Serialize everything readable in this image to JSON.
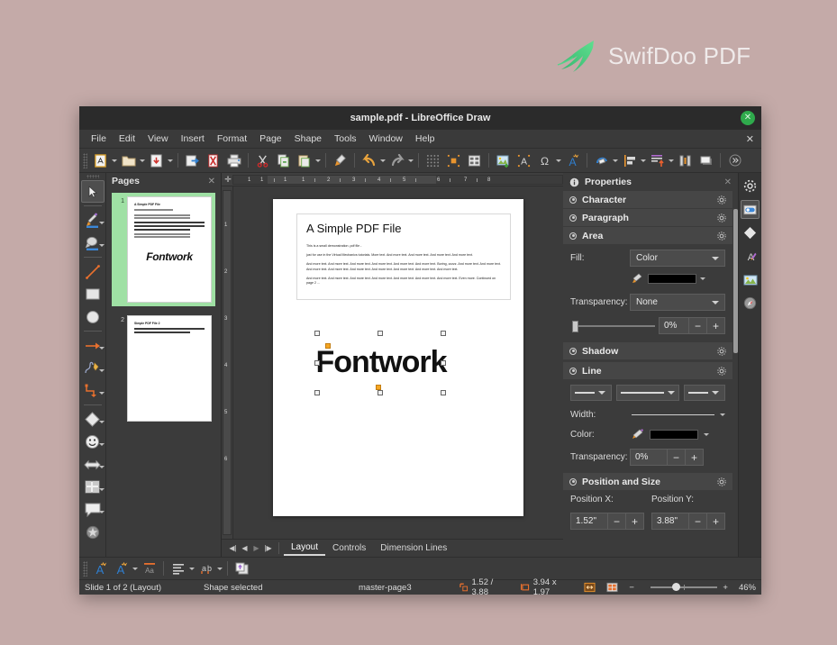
{
  "brand": {
    "name": "SwifDoo PDF",
    "logo_icon": "swallow-bird-icon",
    "logo_color": "#3fc47c"
  },
  "window": {
    "title": "sample.pdf - LibreOffice Draw",
    "close_icon": "close-icon",
    "doc_close_icon": "close-icon"
  },
  "menu": {
    "items": [
      {
        "label": "File"
      },
      {
        "label": "Edit"
      },
      {
        "label": "View"
      },
      {
        "label": "Insert"
      },
      {
        "label": "Format"
      },
      {
        "label": "Page"
      },
      {
        "label": "Shape"
      },
      {
        "label": "Tools"
      },
      {
        "label": "Window"
      },
      {
        "label": "Help"
      }
    ]
  },
  "toolbar": {
    "items": [
      {
        "icon": "new-document-icon",
        "dropdown": true
      },
      {
        "icon": "open-folder-icon",
        "dropdown": true
      },
      {
        "icon": "save-icon",
        "dropdown": true
      },
      {
        "sep": true
      },
      {
        "icon": "export-pdf-icon",
        "dropdown": false
      },
      {
        "icon": "export-directly-as-pdf-icon",
        "dropdown": false
      },
      {
        "icon": "print-icon",
        "dropdown": false
      },
      {
        "sep": true
      },
      {
        "icon": "cut-scissors-icon",
        "dropdown": false
      },
      {
        "icon": "copy-icon",
        "dropdown": false
      },
      {
        "icon": "paste-icon",
        "dropdown": true
      },
      {
        "sep": true
      },
      {
        "icon": "clone-formatting-brush-icon",
        "dropdown": false
      },
      {
        "sep": true
      },
      {
        "icon": "undo-arrow-icon",
        "dropdown": true
      },
      {
        "icon": "redo-arrow-icon",
        "dropdown": true
      },
      {
        "sep": true
      },
      {
        "icon": "display-grid-icon",
        "dropdown": false
      },
      {
        "icon": "snap-to-grid-icon",
        "dropdown": false
      },
      {
        "icon": "display-views-icon",
        "dropdown": false
      },
      {
        "sep": true
      },
      {
        "icon": "insert-image-icon",
        "dropdown": false
      },
      {
        "icon": "insert-text-box-icon",
        "dropdown": false
      },
      {
        "icon": "special-character-omega-icon",
        "dropdown": true
      },
      {
        "icon": "fontwork-text-icon",
        "dropdown": false
      },
      {
        "sep": true
      },
      {
        "icon": "transformations-rotate-icon",
        "dropdown": true
      },
      {
        "icon": "align-objects-icon",
        "dropdown": true
      },
      {
        "icon": "arrange-objects-icon",
        "dropdown": true
      },
      {
        "icon": "distribute-selection-icon",
        "dropdown": false
      },
      {
        "icon": "shadow-icon",
        "dropdown": false
      },
      {
        "sep": true
      },
      {
        "icon": "toolbar-overflow-chevron-icon",
        "dropdown": false
      }
    ]
  },
  "left_toolbar": {
    "items": [
      {
        "icon": "select-arrow-icon",
        "active": true,
        "dropdown": false
      },
      {
        "icon": "fill-color-icon",
        "active": false,
        "dropdown": true,
        "color": "#3b87d8"
      },
      {
        "icon": "line-color-icon",
        "active": false,
        "dropdown": true,
        "color": "#3b87d8"
      },
      {
        "sep": true
      },
      {
        "icon": "insert-line-icon",
        "active": false,
        "dropdown": false
      },
      {
        "icon": "rectangle-icon",
        "active": false,
        "dropdown": false
      },
      {
        "icon": "ellipse-icon",
        "active": false,
        "dropdown": false
      },
      {
        "sep": true
      },
      {
        "icon": "lines-and-arrows-icon",
        "active": false,
        "dropdown": true
      },
      {
        "icon": "curves-and-polygons-icon",
        "active": false,
        "dropdown": true
      },
      {
        "icon": "connectors-icon",
        "active": false,
        "dropdown": true
      },
      {
        "sep": true
      },
      {
        "icon": "basic-shapes-diamond-icon",
        "active": false,
        "dropdown": true
      },
      {
        "icon": "symbol-shapes-smiley-icon",
        "active": false,
        "dropdown": true
      },
      {
        "icon": "block-arrows-icon",
        "active": false,
        "dropdown": true
      },
      {
        "icon": "flowchart-shapes-icon",
        "active": false,
        "dropdown": true
      },
      {
        "icon": "callout-shapes-icon",
        "active": false,
        "dropdown": true
      },
      {
        "icon": "stars-and-banners-icon",
        "active": false,
        "dropdown": false
      }
    ]
  },
  "pages_panel": {
    "title": "Pages",
    "close_icon": "close-icon",
    "thumbnails": [
      {
        "number": "1",
        "selected": true,
        "heading": "A Simple PDF File",
        "has_fontwork": true,
        "fontwork_text": "Fontwork"
      },
      {
        "number": "2",
        "selected": false,
        "heading": "Simple PDF File 2",
        "has_fontwork": false
      }
    ]
  },
  "ruler": {
    "horizontal_ticks": [
      "1",
      "1",
      "1",
      "1",
      "2",
      "3",
      "4",
      "5",
      "6",
      "7",
      "8"
    ],
    "vertical_ticks": [
      "1",
      "2",
      "3",
      "4",
      "5",
      "6"
    ]
  },
  "document": {
    "heading": "A Simple PDF File",
    "paragraphs": [
      "This is a small demonstration .pdf file -",
      "just for use in the Virtual Mechanics tutorials. More text. And more text. And more text. And more text. And more text.",
      "And more text. And more text. And more text. And more text. And more text. And more text. Boring, zzzzz. And more text. And more text. And more text. And more text. And more text. And more text. And more text. And more text. And more text.",
      "And more text. And more text. And more text. And more text. And more text. And more text. And more text. Even more. Continued on page 2 ..."
    ],
    "fontwork": {
      "text": "Fontwork",
      "selected": true,
      "handle_count": 8,
      "adjust_handle_color": "#f5a623"
    }
  },
  "view_tabs": {
    "nav": [
      "first-page-icon",
      "previous-page-icon",
      "next-page-icon",
      "last-page-icon"
    ],
    "tabs": [
      {
        "label": "Layout",
        "active": true
      },
      {
        "label": "Controls",
        "active": false
      },
      {
        "label": "Dimension Lines",
        "active": false
      }
    ]
  },
  "sidebar": {
    "title": "Properties",
    "info_icon": "info-icon",
    "close_icon": "close-icon",
    "sections": [
      {
        "name": "Character",
        "settings_icon": "gear-icon"
      },
      {
        "name": "Paragraph",
        "settings_icon": "gear-icon"
      },
      {
        "name": "Area",
        "settings_icon": "gear-icon"
      },
      {
        "name": "Shadow",
        "settings_icon": "gear-icon"
      },
      {
        "name": "Line",
        "settings_icon": "gear-icon"
      },
      {
        "name": "Position and Size",
        "settings_icon": "gear-icon"
      }
    ],
    "area": {
      "fill_label": "Fill:",
      "fill_value": "Color",
      "fill_color": "#000000",
      "fill_color_icon": "fill-color-bucket-icon",
      "transparency_label": "Transparency:",
      "transparency_value": "None",
      "transparency_percent": "0%",
      "minus_label": "−",
      "plus_label": "+"
    },
    "line": {
      "style_icons": [
        "line-arrow-style-icon",
        "line-style-icon",
        "line-end-style-icon"
      ],
      "width_label": "Width:",
      "color_label": "Color:",
      "line_color": "#000000",
      "color_icon": "line-color-pen-icon",
      "transparency_label": "Transparency:",
      "transparency_value": "0%",
      "minus_label": "−",
      "plus_label": "+"
    },
    "position_size": {
      "pos_x_label": "Position X:",
      "pos_x_value": "1.52\"",
      "pos_y_label": "Position Y:",
      "pos_y_value": "3.88\"",
      "minus_label": "−",
      "plus_label": "+"
    },
    "rail_icons": [
      {
        "icon": "sidebar-settings-gear-icon",
        "active": false
      },
      {
        "icon": "properties-panel-icon",
        "active": true
      },
      {
        "icon": "shapes-panel-icon",
        "active": false
      },
      {
        "icon": "styles-panel-icon",
        "active": false
      },
      {
        "icon": "gallery-panel-icon",
        "active": false
      },
      {
        "icon": "navigator-panel-icon",
        "active": false
      }
    ]
  },
  "bottom_toolbar": {
    "items": [
      {
        "icon": "fontwork-gallery-icon",
        "dropdown": false
      },
      {
        "icon": "fontwork-shape-icon",
        "dropdown": true
      },
      {
        "icon": "fontwork-same-letter-heights-icon",
        "dropdown": false
      },
      {
        "sep": true
      },
      {
        "icon": "fontwork-alignment-icon",
        "dropdown": true
      },
      {
        "icon": "fontwork-character-spacing-icon",
        "dropdown": true
      },
      {
        "sep": true
      },
      {
        "icon": "bring-to-front-icon",
        "dropdown": false
      }
    ]
  },
  "statusbar": {
    "slide_info": "Slide 1 of 2 (Layout)",
    "selection_info": "Shape selected",
    "master_page": "master-page3",
    "cursor_position": "1.52 / 3.88",
    "object_size": "3.94 x 1.97",
    "position_icon": "position-icon",
    "size-icon": "size-icon",
    "fit_slide_icon": "fit-slide-to-window-icon",
    "view_layout_icon": "view-layout-icon",
    "zoom_minus": "−",
    "zoom_plus": "+",
    "zoom_level": "46%"
  }
}
